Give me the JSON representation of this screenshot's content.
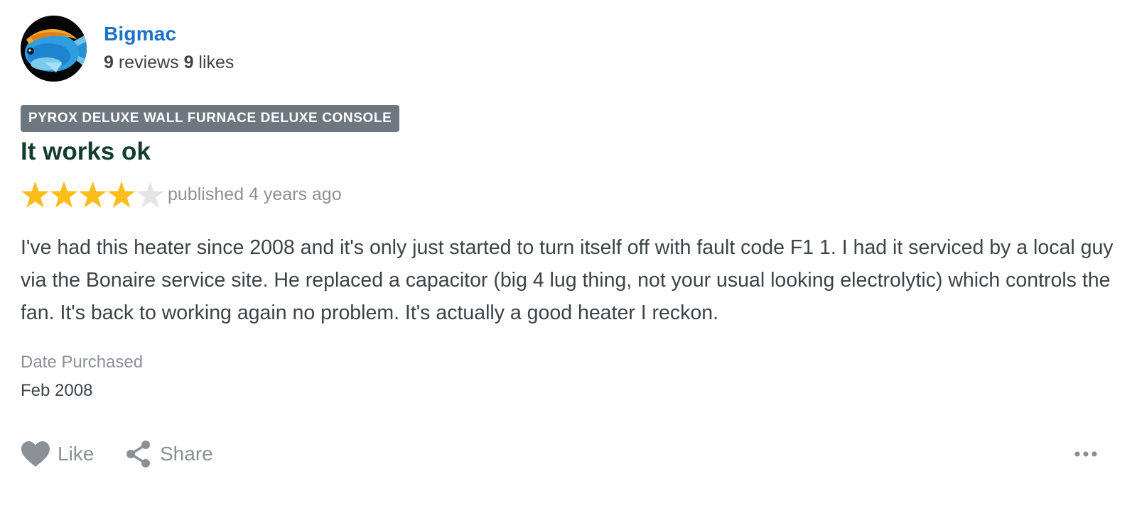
{
  "author": {
    "name": "Bigmac",
    "reviews_count": "9",
    "reviews_label": "reviews",
    "likes_count": "9",
    "likes_label": "likes",
    "avatar_icon": "tang-fish-avatar"
  },
  "review": {
    "product": "PYROX DELUXE WALL FURNACE DELUXE CONSOLE",
    "title": "It works ok",
    "rating": 4,
    "rating_max": 5,
    "published": "published 4 years ago",
    "body": "I've had this heater since 2008 and it's only just started to turn itself off with fault code F1 1. I had it serviced by a local guy via the Bonaire service site. He replaced a capacitor (big 4 lug thing, not your usual looking electrolytic) which controls the fan. It's back to working again no problem. It's actually a good heater I reckon.",
    "date_purchased_label": "Date Purchased",
    "date_purchased": "Feb 2008"
  },
  "actions": {
    "like_label": "Like",
    "share_label": "Share",
    "more_icon": "more-horizontal-icon"
  },
  "colors": {
    "author_name": "#1a73c8",
    "title": "#133d2c",
    "badge_bg": "#6e7780",
    "star_filled": "#fbbd1a",
    "star_empty": "#e4e4e4",
    "muted_text": "#8a9096",
    "body_text": "#3d4348"
  }
}
